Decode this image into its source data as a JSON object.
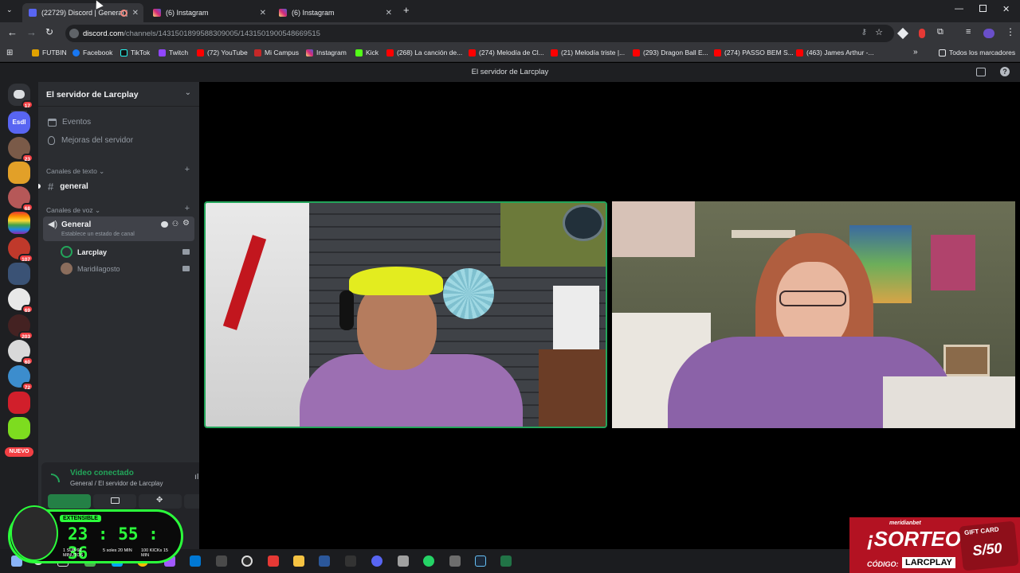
{
  "browser": {
    "tabs": [
      {
        "title": "(22729) Discord | General |",
        "active": true
      },
      {
        "title": "(6) Instagram",
        "active": false
      },
      {
        "title": "(6) Instagram",
        "active": false
      }
    ],
    "url_domain": "discord.com",
    "url_path": "/channels/1431501899588309005/1431501900548669515",
    "bookmarks": [
      "FUTBIN",
      "Facebook",
      "TikTok",
      "Twitch",
      "(72) YouTube",
      "Mi Campus",
      "Instagram",
      "Kick",
      "(268) La canción de...",
      "(274) Melodía de Cl...",
      "(21) Melodía triste |...",
      "(293) Dragon Ball E...",
      "(274) PASSO BEM S...",
      "(463) James Arthur -..."
    ],
    "bookmarks_folder": "Todos los marcadores"
  },
  "discord": {
    "window_title": "El servidor de Larcplay",
    "guild_badges": [
      "17",
      "23",
      "68",
      "107",
      "69",
      "203",
      "60",
      "72",
      "NUEVO"
    ],
    "server_name": "El servidor de Larcplay",
    "menu": {
      "events": "Eventos",
      "boosts": "Mejoras del servidor"
    },
    "text_category": "Canales de texto",
    "text_channel": "general",
    "voice_category": "Canales de voz",
    "voice_channel": "General",
    "voice_status_hint": "Establece un estado de canal",
    "voice_users": [
      "Larcplay",
      "Maridilagosto"
    ],
    "connection": {
      "status": "Video conectado",
      "location": "General / El servidor de Larcplay"
    }
  },
  "overlay": {
    "timer_label": "EXTENSIBLE",
    "timer": "23 : 55 : 36",
    "sub_1": "1 SUB 60 MINUTOS",
    "sub_2": "5 soles 20 MIN",
    "sub_3": "100 KICKs 15 MIN",
    "promo_brand": "meridianbet",
    "promo_title": "¡SORTEO!",
    "promo_code_label": "CÓDIGO:",
    "promo_code": "LARCPLAY",
    "gift_label": "GIFT CARD",
    "gift_value": "S/50"
  },
  "colors": {
    "discord_bg": "#2b2d31",
    "rail_bg": "#1e1f22",
    "speaking_border": "#23a55a",
    "connected_green": "#23a55a",
    "timer_green": "#2bff3b"
  }
}
